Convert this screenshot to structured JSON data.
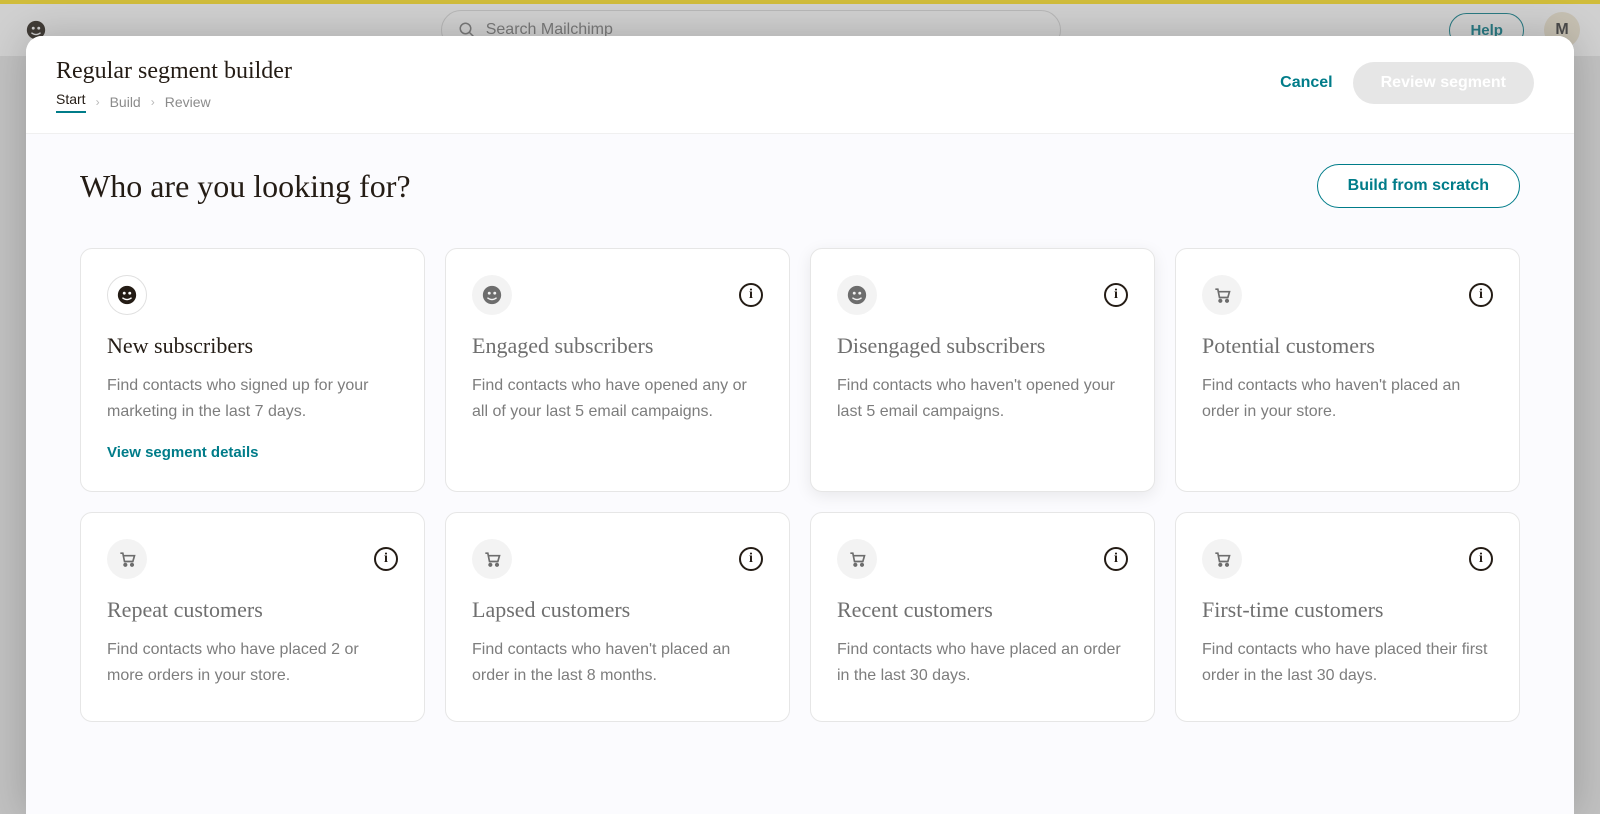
{
  "background": {
    "search_placeholder": "Search Mailchimp",
    "help_label": "Help",
    "avatar_initial": "M"
  },
  "modal": {
    "title": "Regular segment builder",
    "breadcrumb": {
      "start": "Start",
      "build": "Build",
      "review": "Review"
    },
    "cancel_label": "Cancel",
    "review_button": "Review segment"
  },
  "body": {
    "heading": "Who are you looking for?",
    "build_from_scratch": "Build from scratch"
  },
  "cards": {
    "new_subscribers": {
      "title": "New subscribers",
      "desc": "Find contacts who signed up for your marketing in the last 7 days.",
      "link": "View segment details"
    },
    "engaged_subscribers": {
      "title": "Engaged subscribers",
      "desc": "Find contacts who have opened any or all of your last 5 email campaigns."
    },
    "disengaged_subscribers": {
      "title": "Disengaged subscribers",
      "desc": "Find contacts who haven't opened your last 5 email campaigns."
    },
    "potential_customers": {
      "title": "Potential customers",
      "desc": "Find contacts who haven't placed an order in your store."
    },
    "repeat_customers": {
      "title": "Repeat customers",
      "desc": "Find contacts who have placed 2 or more orders in your store."
    },
    "lapsed_customers": {
      "title": "Lapsed customers",
      "desc": "Find contacts who haven't placed an order in the last 8 months."
    },
    "recent_customers": {
      "title": "Recent customers",
      "desc": "Find contacts who have placed an order in the last 30 days."
    },
    "first_time_customers": {
      "title": "First-time customers",
      "desc": "Find contacts who have placed their first order in the last 30 days."
    }
  }
}
